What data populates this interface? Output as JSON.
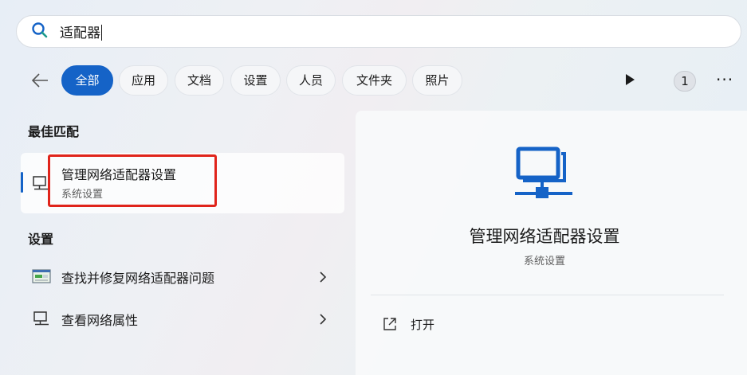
{
  "search": {
    "query": "适配器"
  },
  "filters": {
    "tabs": [
      {
        "label": "全部",
        "active": true
      },
      {
        "label": "应用",
        "active": false
      },
      {
        "label": "文档",
        "active": false
      },
      {
        "label": "设置",
        "active": false
      },
      {
        "label": "人员",
        "active": false
      },
      {
        "label": "文件夹",
        "active": false
      },
      {
        "label": "照片",
        "active": false
      }
    ],
    "count": "1",
    "more": "···"
  },
  "best_match": {
    "heading": "最佳匹配",
    "title": "管理网络适配器设置",
    "subtitle": "系统设置"
  },
  "settings": {
    "heading": "设置",
    "items": [
      {
        "label": "查找并修复网络适配器问题"
      },
      {
        "label": "查看网络属性"
      }
    ]
  },
  "preview": {
    "title": "管理网络适配器设置",
    "subtitle": "系统设置",
    "action_open": "打开"
  },
  "colors": {
    "accent": "#1563c7",
    "highlight": "#e0241b"
  }
}
